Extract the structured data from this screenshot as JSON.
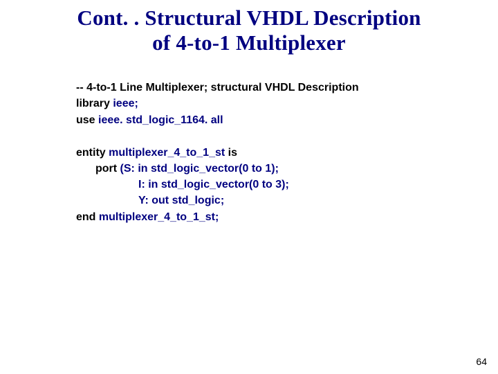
{
  "title_line1": "Cont. . Structural VHDL Description",
  "title_line2": "of 4-to-1 Multiplexer",
  "code": {
    "l1": "-- 4-to-1 Line Multiplexer; structural VHDL Description",
    "l2a": "library ",
    "l2b": "ieee;",
    "l3a": "use ",
    "l3b": "ieee. std_logic_1164. all",
    "l4a": "entity ",
    "l4b": "multiplexer_4_to_1_st ",
    "l4c": "is",
    "l5a": "port ",
    "l5b": "(S: in  std_logic_vector(0 to 1);",
    "l6": "I:  in  std_logic_vector(0 to 3);",
    "l7": "Y:  out std_logic;",
    "l8a": "end ",
    "l8b": "multiplexer_4_to_1_st;"
  },
  "page_number": "64"
}
